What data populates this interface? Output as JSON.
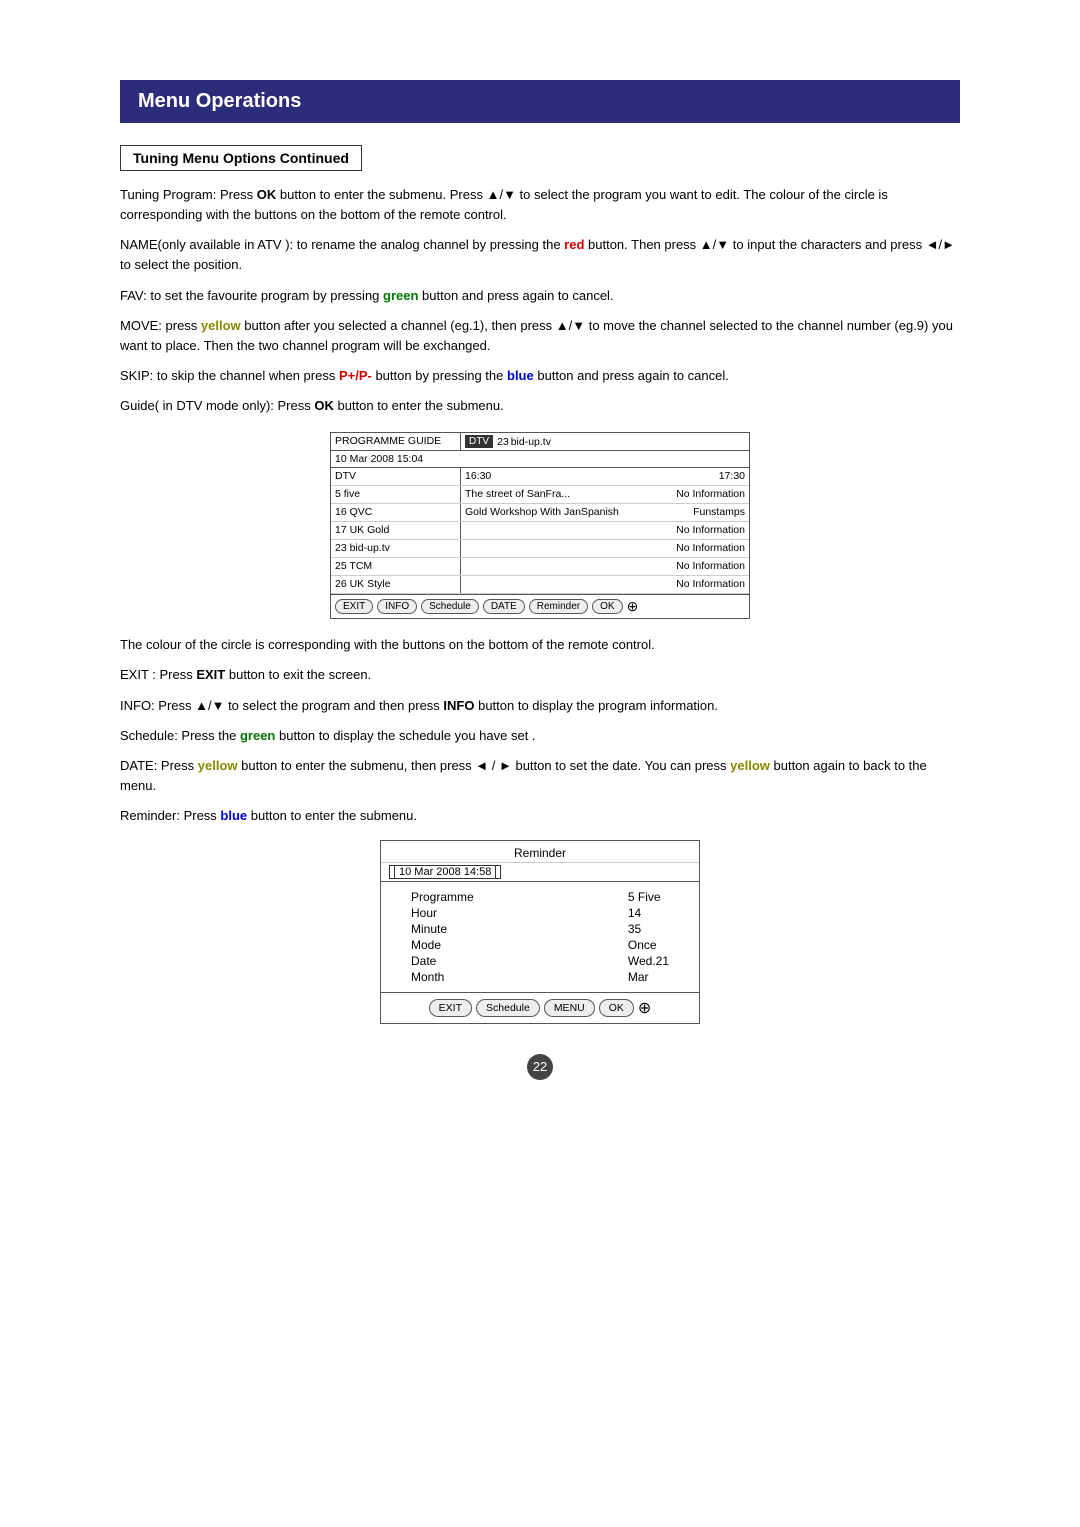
{
  "page": {
    "section_title": "Menu Operations",
    "subsection_title": "Tuning Menu Options Continued",
    "page_number": "22",
    "paragraphs": {
      "tuning_program": "Tuning Program: Press OK button to enter the submenu.  Press ▲/▼ to select the program you want to edit. The colour of the circle is corresponding with the buttons on the bottom of the remote control.",
      "name": "NAME(only available in ATV ): to rename the analog channel by pressing the red button. Then press ▲/▼ to input the characters and press ◄/► to select the position.",
      "fav": "FAV: to set the favourite program by pressing green button and press again to cancel.",
      "move": "MOVE: press yellow button after you selected a channel (eg.1), then press ▲/▼ to move the channel selected to the channel number (eg.9) you want to place.  Then the two channel program will be exchanged.",
      "skip": "SKIP: to skip the channel when press P+/P- button by pressing the blue button and press again to cancel.",
      "guide_intro": "Guide( in DTV mode only): Press OK button to enter the submenu.",
      "colour_note": "The colour of the circle is corresponding with the buttons on the bottom of the remote control.",
      "exit_note": "EXIT : Press EXIT button to exit the screen.",
      "info_note": "INFO: Press ▲/▼ to select the program and then press INFO button to display the program information.",
      "schedule_note": "Schedule: Press the green button to display the schedule you have set .",
      "date_note": "DATE: Press yellow button to enter the submenu, then press ◄ / ► button to set the date. You can press yellow button again to back to the menu.",
      "reminder_note": "Reminder: Press blue button to enter the submenu."
    },
    "guide_table": {
      "header_left": "PROGRAMME GUIDE",
      "header_right_label": "DTV",
      "header_right_channel": "23",
      "header_right_name": "bid-up.tv",
      "date": "10 Mar 2008 15:04",
      "dtv_label": "DTV",
      "time1": "16:30",
      "time2": "17:30",
      "channels": [
        {
          "name": "5 five",
          "info_left": "The street of SanFra...",
          "info_right": "No Information"
        },
        {
          "name": "16 QVC",
          "info_left": "Gold Workshop With JanSpanish",
          "info_right": "Funstamps"
        },
        {
          "name": "17 UK Gold",
          "info_left": "",
          "info_right": "No Information"
        },
        {
          "name": "23 bid-up.tv",
          "info_left": "",
          "info_right": "No Information"
        },
        {
          "name": "25 TCM",
          "info_left": "",
          "info_right": "No Information"
        },
        {
          "name": "26 UK Style",
          "info_left": "",
          "info_right": "No Information"
        }
      ],
      "buttons": [
        "EXIT",
        "INFO",
        "Schedule",
        "DATE",
        "Reminder",
        "OK"
      ]
    },
    "reminder_table": {
      "title": "Reminder",
      "date": "10 Mar 2008 14:58",
      "fields": [
        {
          "label": "Programme",
          "value": "5 Five"
        },
        {
          "label": "Hour",
          "value": "14"
        },
        {
          "label": "Minute",
          "value": "35"
        },
        {
          "label": "Mode",
          "value": "Once"
        },
        {
          "label": "Date",
          "value": "Wed.21"
        },
        {
          "label": "Month",
          "value": "Mar"
        }
      ],
      "buttons": [
        "EXIT",
        "Schedule",
        "MENU",
        "OK"
      ]
    }
  }
}
